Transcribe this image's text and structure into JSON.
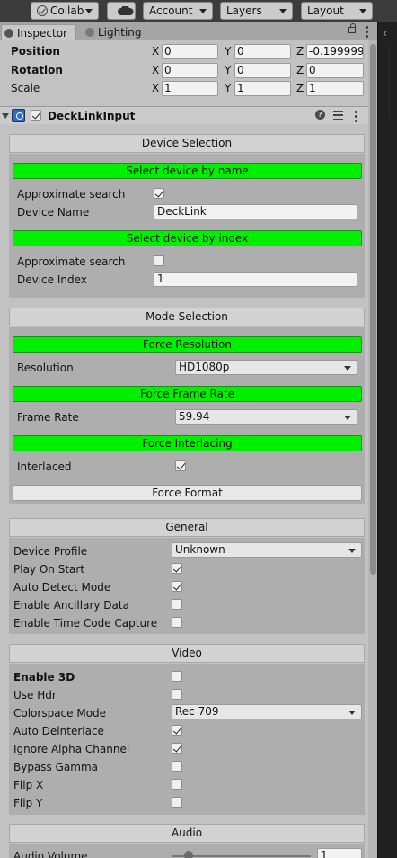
{
  "toolbar": {
    "collab_label": "Collab",
    "account_label": "Account",
    "layers_label": "Layers",
    "layout_label": "Layout"
  },
  "tabs": {
    "inspector": "Inspector",
    "lighting": "Lighting"
  },
  "transform": {
    "position": {
      "label": "Position",
      "x": "0",
      "y": "0",
      "z": "-0.199999"
    },
    "rotation": {
      "label": "Rotation",
      "x": "0",
      "y": "0",
      "z": "0"
    },
    "scale": {
      "label": "Scale",
      "x": "1",
      "y": "1",
      "z": "1"
    },
    "axis_x": "X",
    "axis_y": "Y",
    "axis_z": "Z"
  },
  "component": {
    "title": "DeckLinkInput",
    "enabled": true
  },
  "device_selection": {
    "header": "Device Selection",
    "select_by_name_button": "Select device by name",
    "approx_label_1": "Approximate search",
    "approx_checked_1": true,
    "device_name_label": "Device Name",
    "device_name_value": "DeckLink",
    "select_by_index_button": "Select device by index",
    "approx_label_2": "Approximate search",
    "approx_checked_2": false,
    "device_index_label": "Device Index",
    "device_index_value": "1"
  },
  "mode_selection": {
    "header": "Mode Selection",
    "force_resolution_button": "Force Resolution",
    "resolution_label": "Resolution",
    "resolution_value": "HD1080p",
    "force_frame_rate_button": "Force Frame Rate",
    "frame_rate_label": "Frame Rate",
    "frame_rate_value": "59.94",
    "force_interlacing_button": "Force Interlacing",
    "interlaced_label": "Interlaced",
    "interlaced_checked": true,
    "force_format_button": "Force Format"
  },
  "general": {
    "header": "General",
    "device_profile_label": "Device Profile",
    "device_profile_value": "Unknown",
    "play_on_start_label": "Play On Start",
    "play_on_start": true,
    "auto_detect_label": "Auto Detect Mode",
    "auto_detect": true,
    "ancillary_label": "Enable Ancillary Data",
    "ancillary": false,
    "timecode_label": "Enable Time Code Capture",
    "timecode": false
  },
  "video": {
    "header": "Video",
    "enable_3d_label": "Enable 3D",
    "enable_3d": false,
    "use_hdr_label": "Use Hdr",
    "use_hdr": false,
    "colorspace_label": "Colorspace Mode",
    "colorspace_value": "Rec 709",
    "auto_deinterlace_label": "Auto Deinterlace",
    "auto_deinterlace": true,
    "ignore_alpha_label": "Ignore Alpha Channel",
    "ignore_alpha": true,
    "bypass_gamma_label": "Bypass Gamma",
    "bypass_gamma": false,
    "flip_x_label": "Flip X",
    "flip_x": false,
    "flip_y_label": "Flip Y",
    "flip_y": false
  },
  "audio": {
    "header": "Audio",
    "volume_label": "Audio Volume",
    "volume_value": "1"
  },
  "colors": {
    "green_button": "#00f000",
    "panel_bg": "#c2c2c2",
    "toolbar_bg": "#3c3c3c"
  }
}
